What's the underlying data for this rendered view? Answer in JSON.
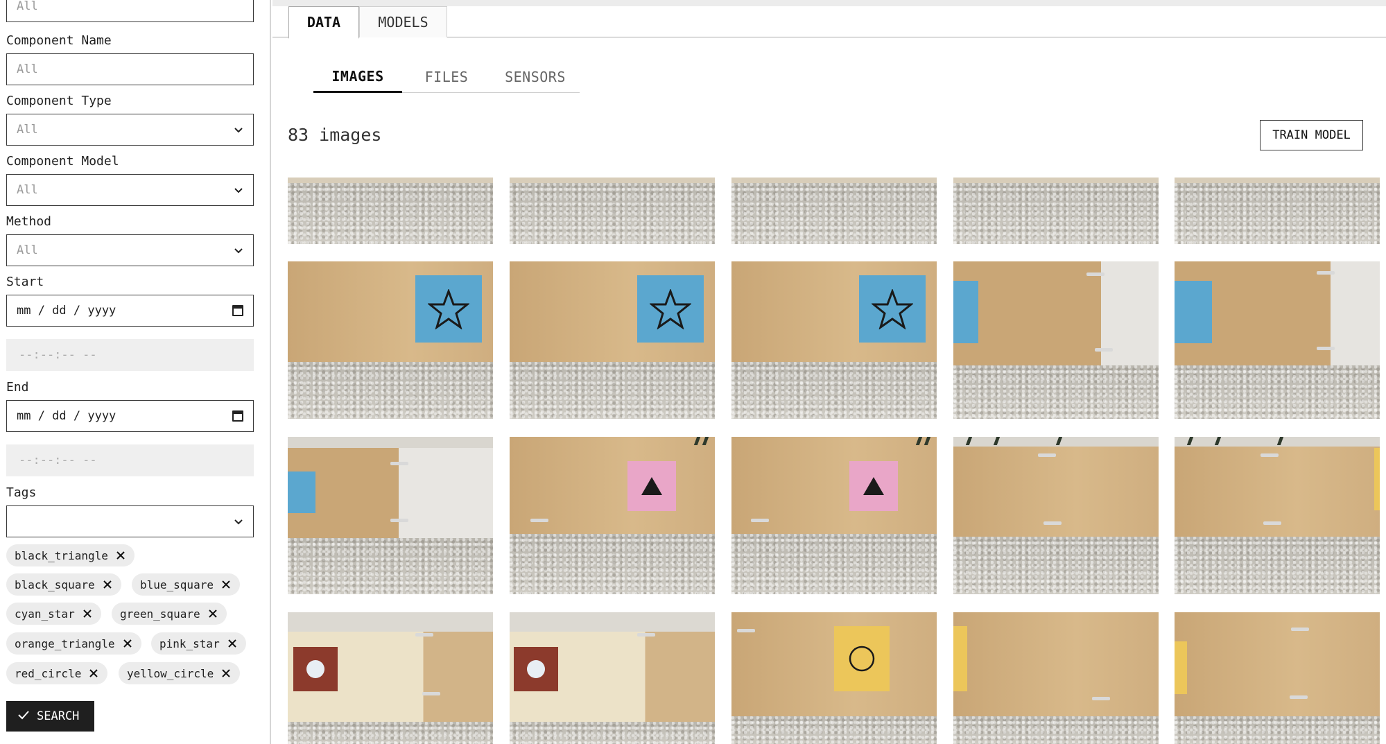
{
  "sidebar": {
    "top_input": {
      "placeholder": "All"
    },
    "component_name": {
      "label": "Component Name",
      "placeholder": "All"
    },
    "component_type": {
      "label": "Component Type",
      "value": "All"
    },
    "component_model": {
      "label": "Component Model",
      "value": "All"
    },
    "method": {
      "label": "Method",
      "value": "All"
    },
    "start": {
      "label": "Start",
      "date_placeholder": "mm / dd / yyyy",
      "time_placeholder": "--:--:-- --"
    },
    "end": {
      "label": "End",
      "date_placeholder": "mm / dd / yyyy",
      "time_placeholder": "--:--:-- --"
    },
    "tags": {
      "label": "Tags",
      "value": "",
      "chips": [
        "black_triangle",
        "black_square",
        "blue_square",
        "cyan_star",
        "green_square",
        "orange_triangle",
        "pink_star",
        "red_circle",
        "yellow_circle"
      ]
    },
    "search_label": "SEARCH"
  },
  "main": {
    "tabs": [
      "DATA",
      "MODELS"
    ],
    "active_tab": "DATA",
    "sub_tabs": [
      "IMAGES",
      "FILES",
      "SENSORS"
    ],
    "active_sub_tab": "IMAGES",
    "count_label": "83 images",
    "train_label": "TRAIN MODEL"
  },
  "colors": {
    "accent": "#1f1f1f",
    "blue_card": "#5ba7cf",
    "pink_card": "#e9a6c8",
    "yellow_card": "#ecc65a",
    "red_card": "#8c3a2c",
    "wood": "#d2b286"
  },
  "thumbnails": [
    {
      "scene": "floor-only"
    },
    {
      "scene": "floor-only"
    },
    {
      "scene": "floor-only"
    },
    {
      "scene": "floor-only"
    },
    {
      "scene": "floor-only"
    },
    {
      "scene": "blue-star-card"
    },
    {
      "scene": "blue-star-card"
    },
    {
      "scene": "blue-star-card"
    },
    {
      "scene": "blue-star-edge-white-panel"
    },
    {
      "scene": "blue-star-edge-white-panel"
    },
    {
      "scene": "blue-star-edge-white-panel"
    },
    {
      "scene": "pink-triangle-card"
    },
    {
      "scene": "pink-triangle-card"
    },
    {
      "scene": "wood-panel-plants"
    },
    {
      "scene": "wood-panel-plants"
    },
    {
      "scene": "red-circle-card"
    },
    {
      "scene": "red-circle-card"
    },
    {
      "scene": "yellow-circle-card"
    },
    {
      "scene": "yellow-edge-wood"
    },
    {
      "scene": "yellow-edge-wood"
    }
  ]
}
